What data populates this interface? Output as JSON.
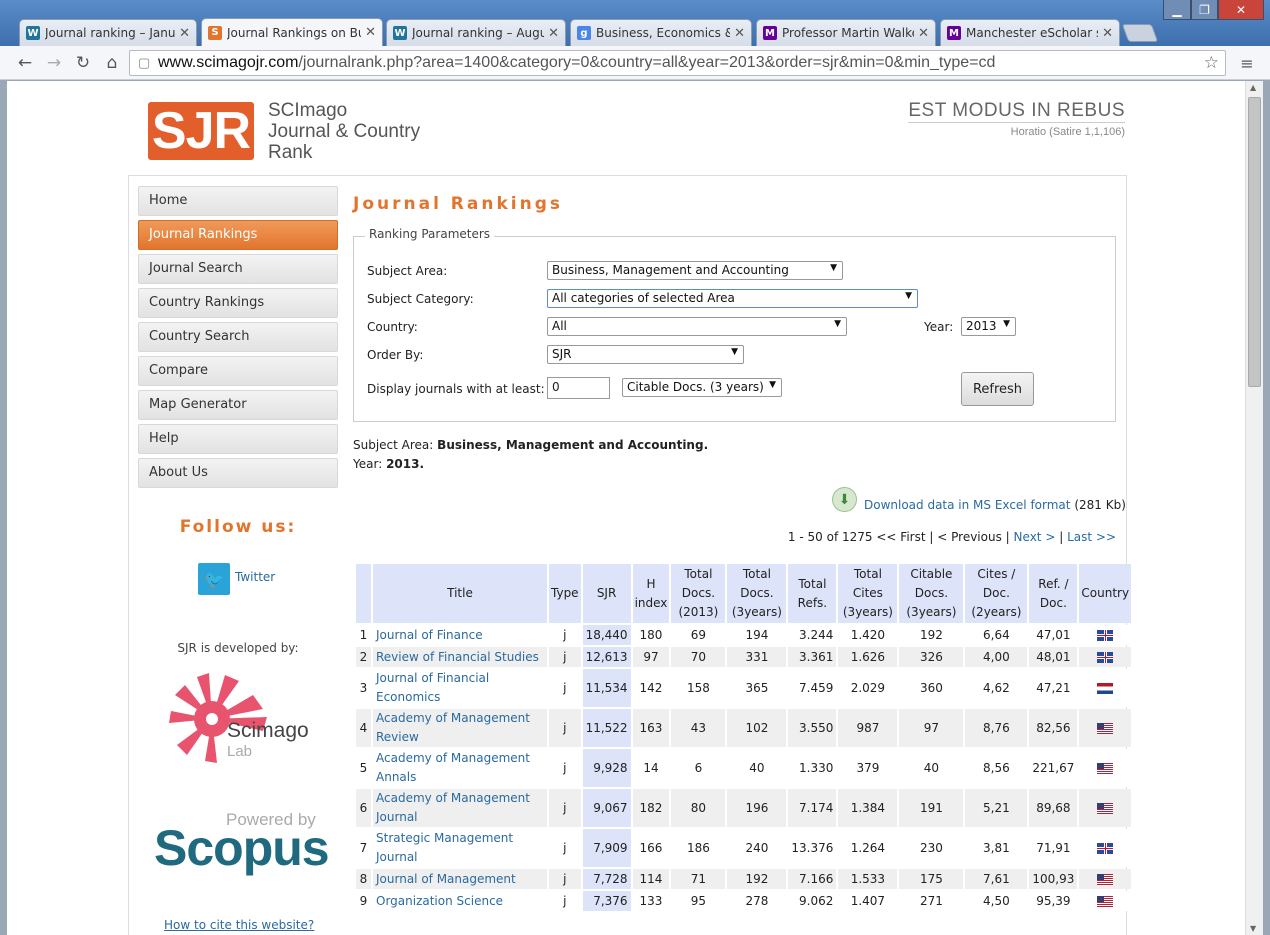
{
  "browser": {
    "tabs": [
      {
        "label": "Journal ranking – Januar",
        "icon": "wordpress-icon",
        "color": "#21759b"
      },
      {
        "label": "Journal Rankings on Busi",
        "icon": "sjr-icon",
        "color": "#e2752d",
        "active": true
      },
      {
        "label": "Journal ranking – August",
        "icon": "wordpress-icon",
        "color": "#21759b"
      },
      {
        "label": "Business, Economics & M",
        "icon": "google-scholar-icon",
        "color": "#4a86e8"
      },
      {
        "label": "Professor Martin Walker",
        "icon": "manchester-icon",
        "color": "#660099"
      },
      {
        "label": "Manchester eScholar sea",
        "icon": "manchester-icon",
        "color": "#660099"
      }
    ],
    "url_domain": "www.scimagojr.com",
    "url_path": "/journalrank.php?area=1400&category=0&country=all&year=2013&order=sjr&min=0&min_type=cd"
  },
  "header": {
    "logo_mark": "SJR",
    "logo_line1": "SCImago",
    "logo_line2": "Journal & Country",
    "logo_line3": "Rank",
    "motto": "EST MODUS IN REBUS",
    "motto_source": "Horatio (Satire 1,1,106)"
  },
  "sidebar": {
    "items": [
      "Home",
      "Journal Rankings",
      "Journal Search",
      "Country Rankings",
      "Country Search",
      "Compare",
      "Map Generator",
      "Help",
      "About Us"
    ],
    "active": "Journal Rankings",
    "follow_us": "Follow us:",
    "twitter": "Twitter",
    "developed_by": "SJR is developed by:",
    "scimago_name": "Scimago",
    "scimago_lab": "Lab",
    "powered_by": "Powered by",
    "scopus": "Scopus",
    "cite": "How to cite this website?"
  },
  "main": {
    "title": "Journal Rankings",
    "params_title": "Ranking Parameters",
    "labels": {
      "subject_area": "Subject Area:",
      "subject_category": "Subject Category:",
      "country": "Country:",
      "order_by": "Order By:",
      "display_min": "Display journals with at least:",
      "year": "Year:"
    },
    "values": {
      "subject_area": "Business, Management and Accounting",
      "subject_category": "All categories of selected Area",
      "country": "All",
      "order_by": "SJR",
      "min": "0",
      "min_type": "Citable Docs. (3 years)",
      "year": "2013"
    },
    "refresh": "Refresh",
    "summary_area_label": "Subject Area:",
    "summary_area": "Business, Management and Accounting.",
    "summary_year_label": "Year:",
    "summary_year": "2013.",
    "download": "Download data in MS Excel format",
    "download_size": "(281 Kb)",
    "pager": {
      "range": "1 - 50 of 1275",
      "first": "<< First",
      "prev": "< Previous",
      "next": "Next >",
      "last": "Last >>",
      "sep": "|"
    }
  },
  "table": {
    "headers": [
      "",
      "Title",
      "Type",
      "SJR",
      "H index",
      "Total Docs. (2013)",
      "Total Docs. (3years)",
      "Total Refs.",
      "Total Cites (3years)",
      "Citable Docs. (3years)",
      "Cites / Doc. (2years)",
      "Ref. / Doc.",
      "Country"
    ],
    "rows": [
      {
        "rank": "1",
        "title": "Journal of Finance",
        "type": "j",
        "sjr": "18,440",
        "h": "180",
        "docs": "69",
        "docs3": "194",
        "refs": "3.244",
        "cites3": "1.420",
        "citable3": "192",
        "cpd": "6,64",
        "rpd": "47,01",
        "country": "gb"
      },
      {
        "rank": "2",
        "title": "Review of Financial Studies",
        "type": "j",
        "sjr": "12,613",
        "h": "97",
        "docs": "70",
        "docs3": "331",
        "refs": "3.361",
        "cites3": "1.626",
        "citable3": "326",
        "cpd": "4,00",
        "rpd": "48,01",
        "country": "gb"
      },
      {
        "rank": "3",
        "title": "Journal of Financial Economics",
        "type": "j",
        "sjr": "11,534",
        "h": "142",
        "docs": "158",
        "docs3": "365",
        "refs": "7.459",
        "cites3": "2.029",
        "citable3": "360",
        "cpd": "4,62",
        "rpd": "47,21",
        "country": "nl"
      },
      {
        "rank": "4",
        "title": "Academy of Management Review",
        "type": "j",
        "sjr": "11,522",
        "h": "163",
        "docs": "43",
        "docs3": "102",
        "refs": "3.550",
        "cites3": "987",
        "citable3": "97",
        "cpd": "8,76",
        "rpd": "82,56",
        "country": "us"
      },
      {
        "rank": "5",
        "title": "Academy of Management Annals",
        "type": "j",
        "sjr": "9,928",
        "h": "14",
        "docs": "6",
        "docs3": "40",
        "refs": "1.330",
        "cites3": "379",
        "citable3": "40",
        "cpd": "8,56",
        "rpd": "221,67",
        "country": "us"
      },
      {
        "rank": "6",
        "title": "Academy of Management Journal",
        "type": "j",
        "sjr": "9,067",
        "h": "182",
        "docs": "80",
        "docs3": "196",
        "refs": "7.174",
        "cites3": "1.384",
        "citable3": "191",
        "cpd": "5,21",
        "rpd": "89,68",
        "country": "us"
      },
      {
        "rank": "7",
        "title": "Strategic Management Journal",
        "type": "j",
        "sjr": "7,909",
        "h": "166",
        "docs": "186",
        "docs3": "240",
        "refs": "13.376",
        "cites3": "1.264",
        "citable3": "230",
        "cpd": "3,81",
        "rpd": "71,91",
        "country": "gb"
      },
      {
        "rank": "8",
        "title": "Journal of Management",
        "type": "j",
        "sjr": "7,728",
        "h": "114",
        "docs": "71",
        "docs3": "192",
        "refs": "7.166",
        "cites3": "1.533",
        "citable3": "175",
        "cpd": "7,61",
        "rpd": "100,93",
        "country": "us"
      },
      {
        "rank": "9",
        "title": "Organization Science",
        "type": "j",
        "sjr": "7,376",
        "h": "133",
        "docs": "95",
        "docs3": "278",
        "refs": "9.062",
        "cites3": "1.407",
        "citable3": "271",
        "cpd": "4,50",
        "rpd": "95,39",
        "country": "us"
      }
    ]
  }
}
